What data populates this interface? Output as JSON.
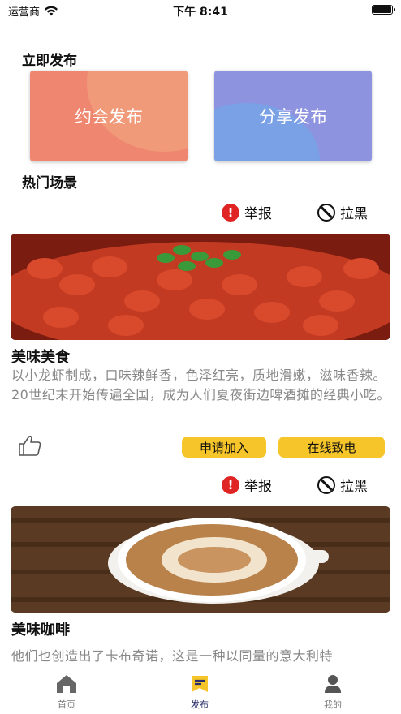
{
  "status_bar": {
    "carrier": "运营商",
    "time": "下午 8:41"
  },
  "publish": {
    "title": "立即发布",
    "cards": [
      {
        "label": "约会发布",
        "color": "#ef8670"
      },
      {
        "label": "分享发布",
        "color": "#8e93e0"
      }
    ]
  },
  "hot": {
    "title": "热门场景"
  },
  "actions": {
    "report_label": "举报",
    "block_label": "拉黑"
  },
  "posts": [
    {
      "title": "美味美食",
      "description": "以小龙虾制成，口味辣鲜香，色泽红亮，质地滑嫩，滋味香辣。20世纪末开始传遍全国，成为人们夏夜街边啤酒摊的经典小吃。",
      "apply_label": "申请加入",
      "call_label": "在线致电"
    },
    {
      "title": "美味咖啡",
      "description": "他们也创造出了卡布奇诺，这是一种以同量的意大利特"
    }
  ],
  "tabbar": {
    "items": [
      {
        "label": "首页",
        "icon": "home-icon"
      },
      {
        "label": "发布",
        "icon": "publish-icon",
        "active": true
      },
      {
        "label": "我的",
        "icon": "profile-icon"
      }
    ]
  },
  "colors": {
    "accent_button": "#f6c52a",
    "report_red": "#e02424",
    "active_tab": "#2a2f6a"
  }
}
